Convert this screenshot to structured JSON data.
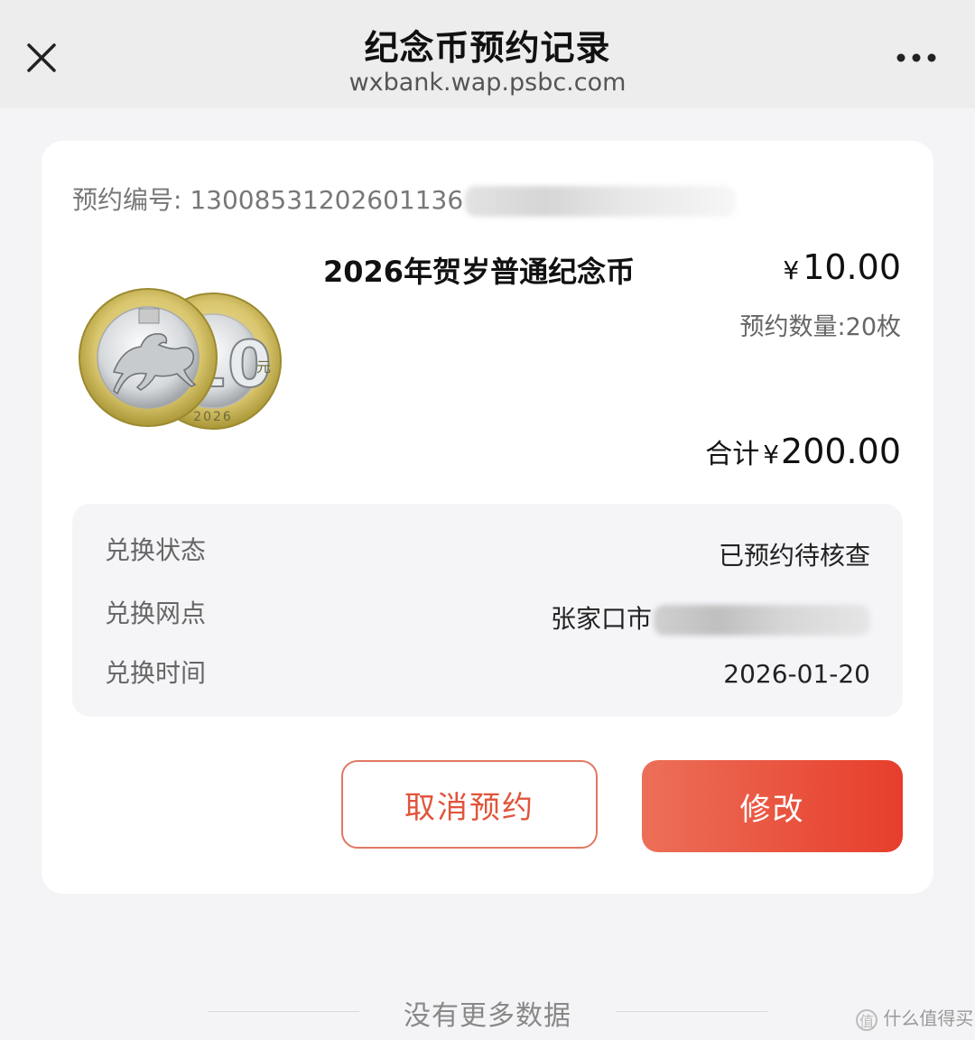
{
  "header": {
    "title": "纪念币预约记录",
    "url": "wxbank.wap.psbc.com",
    "close_icon": "close-icon",
    "more_icon": "more-horizontal-icon"
  },
  "order": {
    "number_label": "预约编号:",
    "number_visible": "13008531202601136"
  },
  "product": {
    "name": "2026年贺岁普通纪念币",
    "currency": "¥",
    "price": "10.00",
    "quantity": "预约数量:20枚",
    "total_label": "合计",
    "total": "200.00",
    "coin_face_value": "10",
    "coin_unit": "元",
    "coin_year": "2026"
  },
  "exchange": {
    "status_label": "兑换状态",
    "status_value": "已预约待核查",
    "branch_label": "兑换网点",
    "branch_value_visible": "张家口市",
    "time_label": "兑换时间",
    "time_value": "2026-01-20"
  },
  "actions": {
    "cancel_label": "取消预约",
    "modify_label": "修改"
  },
  "footer": {
    "no_more": "没有更多数据",
    "watermark": "什么值得买"
  },
  "colors": {
    "accent": "#e73e2c",
    "accent_light": "#ec6f58",
    "background": "#f4f4f6"
  }
}
